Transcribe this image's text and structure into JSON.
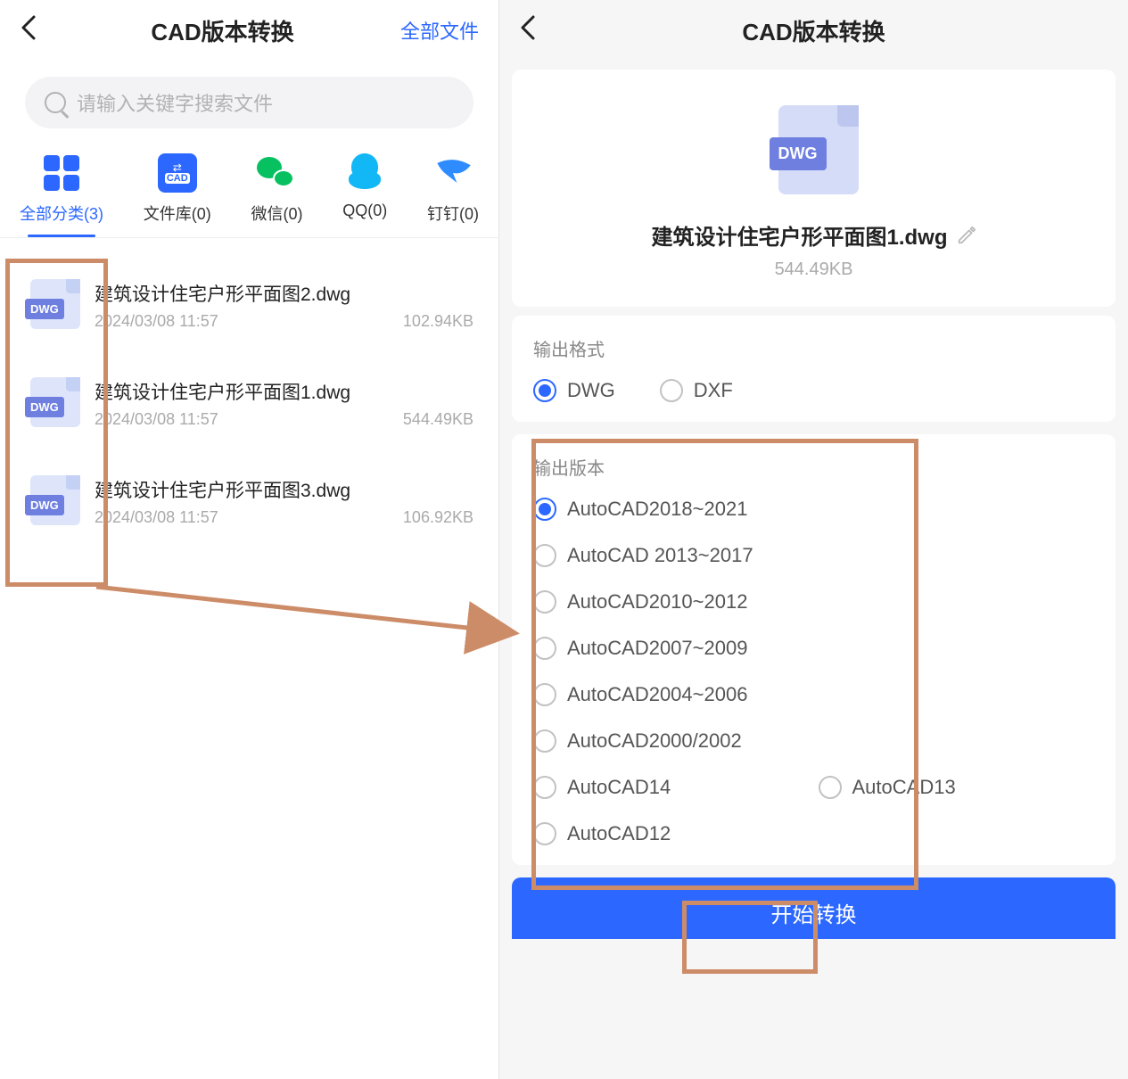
{
  "left": {
    "title": "CAD版本转换",
    "action": "全部文件",
    "searchPlaceholder": "请输入关键字搜索文件",
    "tabs": [
      {
        "label": "全部分类(3)"
      },
      {
        "label": "文件库(0)"
      },
      {
        "label": "微信(0)"
      },
      {
        "label": "QQ(0)"
      },
      {
        "label": "钉钉(0)"
      }
    ],
    "files": [
      {
        "badge": "DWG",
        "name": "建筑设计住宅户形平面图2.dwg",
        "date": "2024/03/08  11:57",
        "size": "102.94KB"
      },
      {
        "badge": "DWG",
        "name": "建筑设计住宅户形平面图1.dwg",
        "date": "2024/03/08  11:57",
        "size": "544.49KB"
      },
      {
        "badge": "DWG",
        "name": "建筑设计住宅户形平面图3.dwg",
        "date": "2024/03/08  11:57",
        "size": "106.92KB"
      }
    ]
  },
  "right": {
    "title": "CAD版本转换",
    "file": {
      "badge": "DWG",
      "name": "建筑设计住宅户形平面图1.dwg",
      "size": "544.49KB"
    },
    "formatLabel": "输出格式",
    "formats": [
      {
        "label": "DWG",
        "selected": true
      },
      {
        "label": "DXF",
        "selected": false
      }
    ],
    "versionLabel": "输出版本",
    "versions": [
      {
        "label": "AutoCAD2018~2021",
        "selected": true,
        "full": true
      },
      {
        "label": "AutoCAD 2013~2017",
        "selected": false,
        "full": true
      },
      {
        "label": "AutoCAD2010~2012",
        "selected": false,
        "full": true
      },
      {
        "label": "AutoCAD2007~2009",
        "selected": false,
        "full": true
      },
      {
        "label": "AutoCAD2004~2006",
        "selected": false,
        "full": true
      },
      {
        "label": "AutoCAD2000/2002",
        "selected": false,
        "full": true
      },
      {
        "label": "AutoCAD14",
        "selected": false,
        "full": false
      },
      {
        "label": "AutoCAD13",
        "selected": false,
        "full": false
      },
      {
        "label": "AutoCAD12",
        "selected": false,
        "full": true
      }
    ],
    "convertLabel": "开始转换"
  }
}
